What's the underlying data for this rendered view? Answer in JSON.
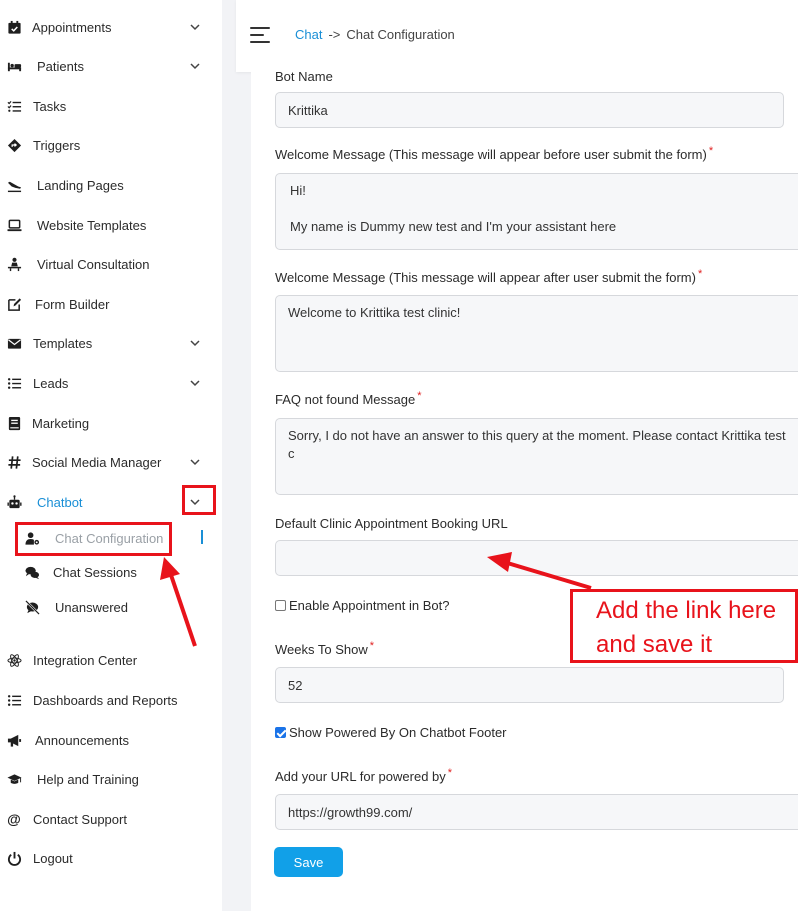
{
  "sidebar": {
    "items": [
      {
        "label": "Appointments",
        "icon": "calendar-check-icon",
        "chevron": true
      },
      {
        "label": "Patients",
        "icon": "bed-icon",
        "chevron": true
      },
      {
        "label": "Tasks",
        "icon": "task-list-icon",
        "chevron": false
      },
      {
        "label": "Triggers",
        "icon": "diamond-arrow-icon",
        "chevron": false
      },
      {
        "label": "Landing Pages",
        "icon": "plane-landing-icon",
        "chevron": false
      },
      {
        "label": "Website Templates",
        "icon": "laptop-icon",
        "chevron": false
      },
      {
        "label": "Virtual Consultation",
        "icon": "person-desk-icon",
        "chevron": false
      },
      {
        "label": "Form Builder",
        "icon": "edit-icon",
        "chevron": false
      },
      {
        "label": "Templates",
        "icon": "envelope-icon",
        "chevron": true
      },
      {
        "label": "Leads",
        "icon": "list-icon",
        "chevron": true
      },
      {
        "label": "Marketing",
        "icon": "book-icon",
        "chevron": false
      },
      {
        "label": "Social Media Manager",
        "icon": "hashtag-icon",
        "chevron": true
      },
      {
        "label": "Chatbot",
        "icon": "robot-icon",
        "chevron": true
      }
    ],
    "chatbot_sub": [
      {
        "label": "Chat Configuration",
        "icon": "user-gear-icon"
      },
      {
        "label": "Chat Sessions",
        "icon": "chat-bubbles-icon"
      },
      {
        "label": "Unanswered",
        "icon": "comment-slash-icon"
      }
    ],
    "bottom_items": [
      {
        "label": "Integration Center",
        "icon": "atom-icon"
      },
      {
        "label": "Dashboards and Reports",
        "icon": "list-icon"
      },
      {
        "label": "Announcements",
        "icon": "megaphone-icon"
      },
      {
        "label": "Help and Training",
        "icon": "graduation-cap-icon"
      },
      {
        "label": "Contact Support",
        "icon": "at-sign-icon"
      },
      {
        "label": "Logout",
        "icon": "power-icon"
      }
    ]
  },
  "header": {
    "crumb_root": "Chat",
    "crumb_sep": "->",
    "crumb_current": "Chat Configuration"
  },
  "form": {
    "bot_name_label": "Bot Name",
    "bot_name_value": "Krittika",
    "welcome_before_label": "Welcome Message (This message will appear before user submit the form)",
    "welcome_before_value": "Hi!\n\nMy name is Dummy new test and I'm your assistant here",
    "welcome_after_label": "Welcome Message (This message will appear after user submit the form)",
    "welcome_after_value": "Welcome to Krittika test clinic!",
    "faq_label": "FAQ not found Message",
    "faq_value": "Sorry, I do not have an answer to this query at the moment. Please contact Krittika test c",
    "booking_url_label": "Default Clinic Appointment Booking URL",
    "booking_url_value": "",
    "enable_appt_label": "Enable Appointment in Bot?",
    "enable_appt_checked": false,
    "weeks_label": "Weeks To Show",
    "weeks_value": "52",
    "powered_label": "Show Powered By On Chatbot Footer",
    "powered_checked": true,
    "powered_url_label": "Add your URL for powered by",
    "powered_url_value": "https://growth99.com/",
    "required_mark": "*",
    "save_label": "Save"
  },
  "annotation": {
    "callout_line1": "Add the link here",
    "callout_line2": "and save it",
    "color": "#e8131b"
  },
  "colors": {
    "accent": "#1a8fd6",
    "button": "#11a0e8",
    "required": "#e02020"
  }
}
